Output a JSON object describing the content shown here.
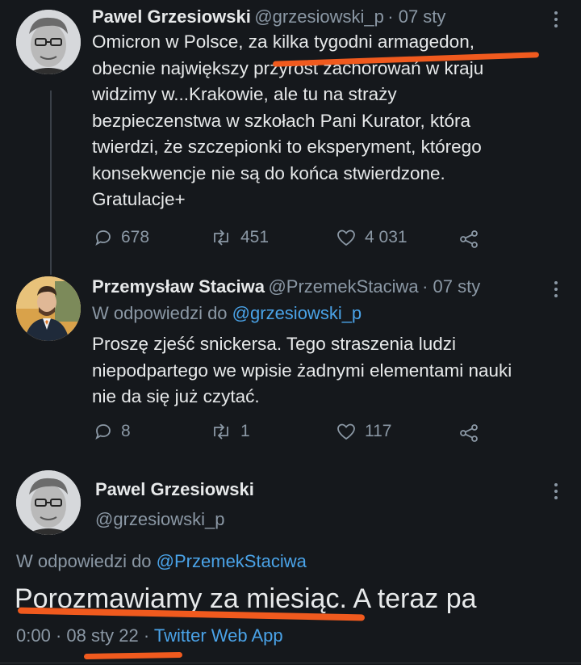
{
  "tweet1": {
    "name": "Pawel Grzesiowski",
    "handle": "@grzesiowski_p",
    "date": "· 07 sty",
    "lines": [
      "Omicron w Polsce, za kilka tygodni armagedon,",
      "obecnie największy przyrost zachorowań w kraju",
      "widzimy w...Krakowie, ale tu na straży",
      "bezpieczenstwa w szkołach Pani Kurator, która",
      "twierdzi, że szczepionki to eksperyment, którego",
      "konsekwencje nie są do końca stwierdzone.",
      "Gratulacje+"
    ],
    "replies": "678",
    "retweets": "451",
    "likes": "4 031"
  },
  "tweet2": {
    "name": "Przemysław Staciwa",
    "handle": "@PrzemekStaciwa",
    "date": "· 07 sty",
    "reply_prefix": "W odpowiedzi do",
    "reply_handle": "@grzesiowski_p",
    "lines": [
      "Proszę zjeść snickersa. Tego straszenia ludzi",
      "niepodpartego we wpisie żadnymi elementami nauki",
      "nie da się już czytać."
    ],
    "replies": "8",
    "retweets": "1",
    "likes": "117"
  },
  "tweet3": {
    "name": "Pawel Grzesiowski",
    "handle": "@grzesiowski_p",
    "reply_prefix": "W odpowiedzi do",
    "reply_handle": "@PrzemekStaciwa",
    "text": "Porozmawiamy za miesiąc. A teraz pa",
    "time": "0:00",
    "sep1": "·",
    "date": "08 sty 22",
    "sep2": "·",
    "source": "Twitter Web App"
  },
  "colors": {
    "background": "#15181c",
    "text": "#e7e9ea",
    "muted": "#8b98a5",
    "link": "#4aa3e8",
    "annotation": "#f05a1e"
  },
  "icons": [
    "reply-icon",
    "retweet-icon",
    "like-icon",
    "share-icon",
    "more-icon"
  ]
}
